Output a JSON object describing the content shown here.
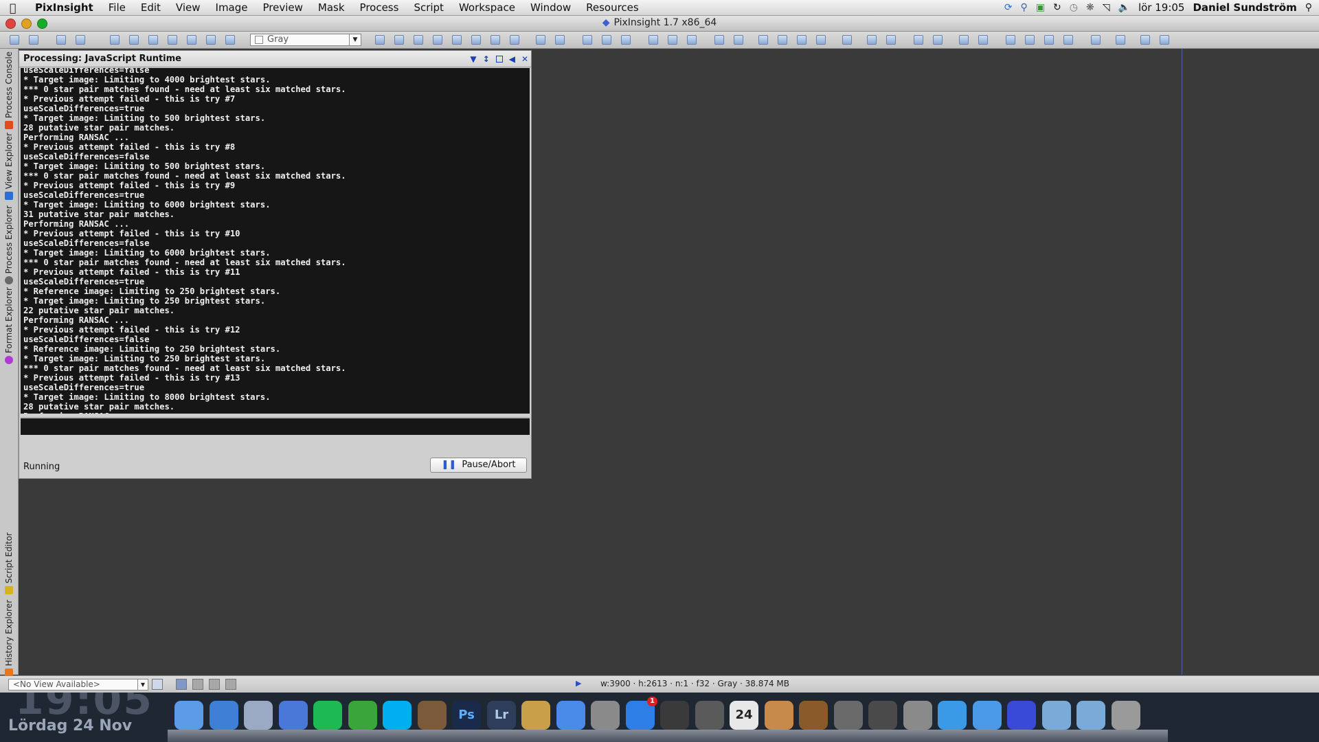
{
  "menubar": {
    "app_name": "PixInsight",
    "items": [
      "File",
      "Edit",
      "View",
      "Image",
      "Preview",
      "Mask",
      "Process",
      "Script",
      "Workspace",
      "Window",
      "Resources"
    ],
    "clock": "lör 19:05",
    "user": "Daniel Sundström"
  },
  "window": {
    "title": "PixInsight 1.7 x86_64"
  },
  "toolbar": {
    "channel_select": "Gray"
  },
  "left_dock": {
    "tabs": [
      "Process Console",
      "View Explorer",
      "Process Explorer",
      "Format Explorer",
      "Script Editor",
      "History Explorer"
    ]
  },
  "console_panel": {
    "title": "Processing: JavaScript Runtime",
    "lines": [
      "useScaleDifferences=false",
      "* Target image: Limiting to 4000 brightest stars.",
      "*** 0 star pair matches found - need at least six matched stars.",
      "* Previous attempt failed - this is try #7",
      "useScaleDifferences=true",
      "* Target image: Limiting to 500 brightest stars.",
      "28 putative star pair matches.",
      "Performing RANSAC ...",
      "* Previous attempt failed - this is try #8",
      "useScaleDifferences=false",
      "* Target image: Limiting to 500 brightest stars.",
      "*** 0 star pair matches found - need at least six matched stars.",
      "* Previous attempt failed - this is try #9",
      "useScaleDifferences=true",
      "* Target image: Limiting to 6000 brightest stars.",
      "31 putative star pair matches.",
      "Performing RANSAC ...",
      "* Previous attempt failed - this is try #10",
      "useScaleDifferences=false",
      "* Target image: Limiting to 6000 brightest stars.",
      "*** 0 star pair matches found - need at least six matched stars.",
      "* Previous attempt failed - this is try #11",
      "useScaleDifferences=true",
      "* Reference image: Limiting to 250 brightest stars.",
      "* Target image: Limiting to 250 brightest stars.",
      "22 putative star pair matches.",
      "Performing RANSAC ...",
      "* Previous attempt failed - this is try #12",
      "useScaleDifferences=false",
      "* Reference image: Limiting to 250 brightest stars.",
      "* Target image: Limiting to 250 brightest stars.",
      "*** 0 star pair matches found - need at least six matched stars.",
      "* Previous attempt failed - this is try #13",
      "useScaleDifferences=true",
      "* Target image: Limiting to 8000 brightest stars.",
      "28 putative star pair matches.",
      "Performing RANSAC ..."
    ],
    "status": "Running",
    "pause_label": "Pause/Abort"
  },
  "statusbar": {
    "view_select": "<No View Available>",
    "info": "w:3900 · h:2613 · n:1 · f32 · Gray · 38.874 MB"
  },
  "desktop": {
    "clock": "19:05",
    "date": "Lördag 24 Nov",
    "calendar_day": "24",
    "appstore_badge": "1"
  },
  "dock_apps": [
    "Finder",
    "Safari",
    "Mail",
    "iTunes",
    "Spotify",
    "uTorrent",
    "Skype",
    "iPhoto",
    "Photoshop",
    "Lightroom",
    "Preview",
    "Mail",
    "Launchpad",
    "App Store",
    "FaceTime",
    "Photo Booth",
    "Calendar",
    "Address Book",
    "GarageBand",
    "iMovie",
    "Photo Browser",
    "System Preferences",
    "Messages",
    "Contacts",
    "PixInsight",
    "Documents",
    "Downloads",
    "Trash"
  ]
}
